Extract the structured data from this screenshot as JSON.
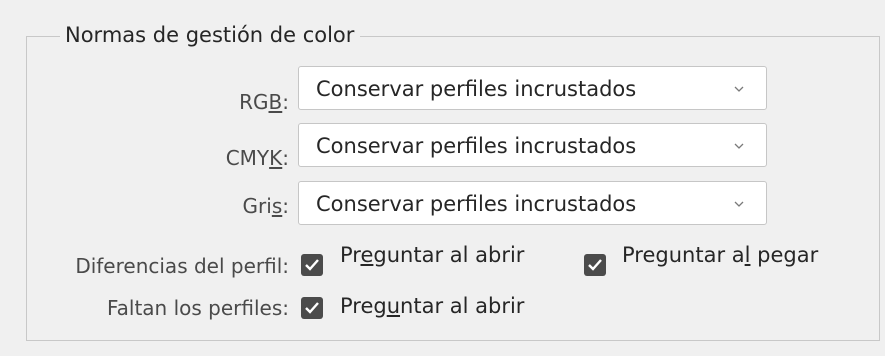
{
  "group": {
    "title": "Normas de gestión de color"
  },
  "rgb": {
    "label_pre": "RG",
    "label_key": "B",
    "label_post": ":",
    "value": "Conservar perfiles incrustados"
  },
  "cmyk": {
    "label_pre": "CMY",
    "label_key": "K",
    "label_post": ":",
    "value": "Conservar perfiles incrustados"
  },
  "gray": {
    "label_pre": "Gri",
    "label_key": "s",
    "label_post": ":",
    "value": "Conservar perfiles incrustados"
  },
  "profile_mismatch": {
    "label": "Diferencias del perfil:",
    "ask_open": {
      "checked": true,
      "label_pre": "Pr",
      "label_key": "e",
      "label_post": "guntar al abrir"
    },
    "ask_paste": {
      "checked": true,
      "label_pre": "Preguntar a",
      "label_key": "l",
      "label_post": " pegar"
    }
  },
  "missing_profiles": {
    "label": "Faltan los perfiles:",
    "ask_open": {
      "checked": true,
      "label_pre": "Preg",
      "label_key": "u",
      "label_post": "ntar al abrir"
    }
  },
  "icons": {
    "dropdown": "chevron-down-icon",
    "check": "checkmark-icon"
  },
  "colors": {
    "checkbox_fill": "#4b4b4b",
    "panel_bg": "#f0f0f0"
  }
}
